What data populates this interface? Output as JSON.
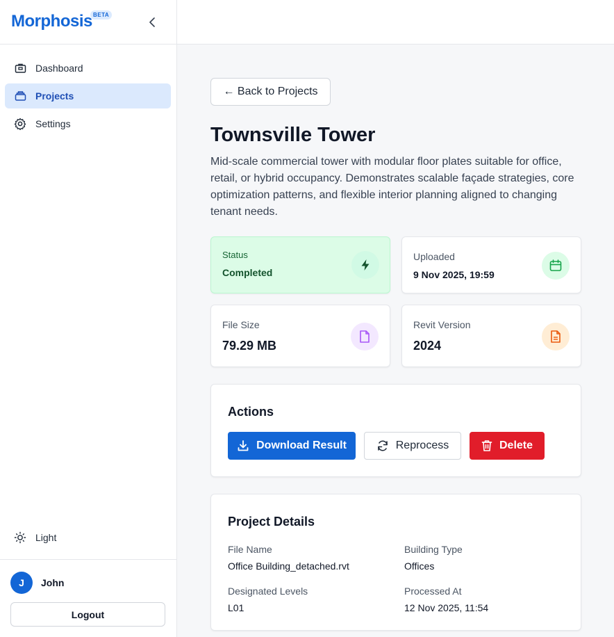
{
  "sidebar": {
    "brand": "Morphosis",
    "badge": "BETA",
    "nav": [
      {
        "label": "Dashboard",
        "icon": "briefcase-icon"
      },
      {
        "label": "Projects",
        "icon": "folder-icon",
        "active": true
      },
      {
        "label": "Settings",
        "icon": "gear-icon"
      }
    ],
    "theme_label": "Light",
    "user": {
      "initial": "J",
      "name": "John"
    },
    "logout_label": "Logout"
  },
  "main": {
    "back_label": "← Back to Projects",
    "title": "Townsville Tower",
    "description": "Mid-scale commercial tower with modular floor plates suitable for office, retail, or hybrid occupancy. Demonstrates scalable façade strategies, core optimization patterns, and flexible interior planning aligned to changing tenant needs.",
    "stats": {
      "status": {
        "label": "Status",
        "value": "Completed",
        "icon": "lightning-icon"
      },
      "uploaded": {
        "label": "Uploaded",
        "value": "9 Nov 2025, 19:59",
        "icon": "calendar-icon"
      },
      "file_size": {
        "label": "File Size",
        "value": "79.29 MB",
        "icon": "file-icon"
      },
      "revit_version": {
        "label": "Revit Version",
        "value": "2024",
        "icon": "document-icon"
      }
    },
    "actions": {
      "title": "Actions",
      "download_label": "Download Result",
      "reprocess_label": "Reprocess",
      "delete_label": "Delete"
    },
    "details": {
      "title": "Project Details",
      "file_name_label": "File Name",
      "file_name": "Office Building_detached.rvt",
      "building_type_label": "Building Type",
      "building_type": "Offices",
      "levels_label": "Designated Levels",
      "levels": "L01",
      "processed_label": "Processed At",
      "processed": "12 Nov 2025, 11:54"
    }
  },
  "colors": {
    "accent": "#1366d6",
    "success_bg": "#dcfce7",
    "danger": "#e11d2a"
  }
}
